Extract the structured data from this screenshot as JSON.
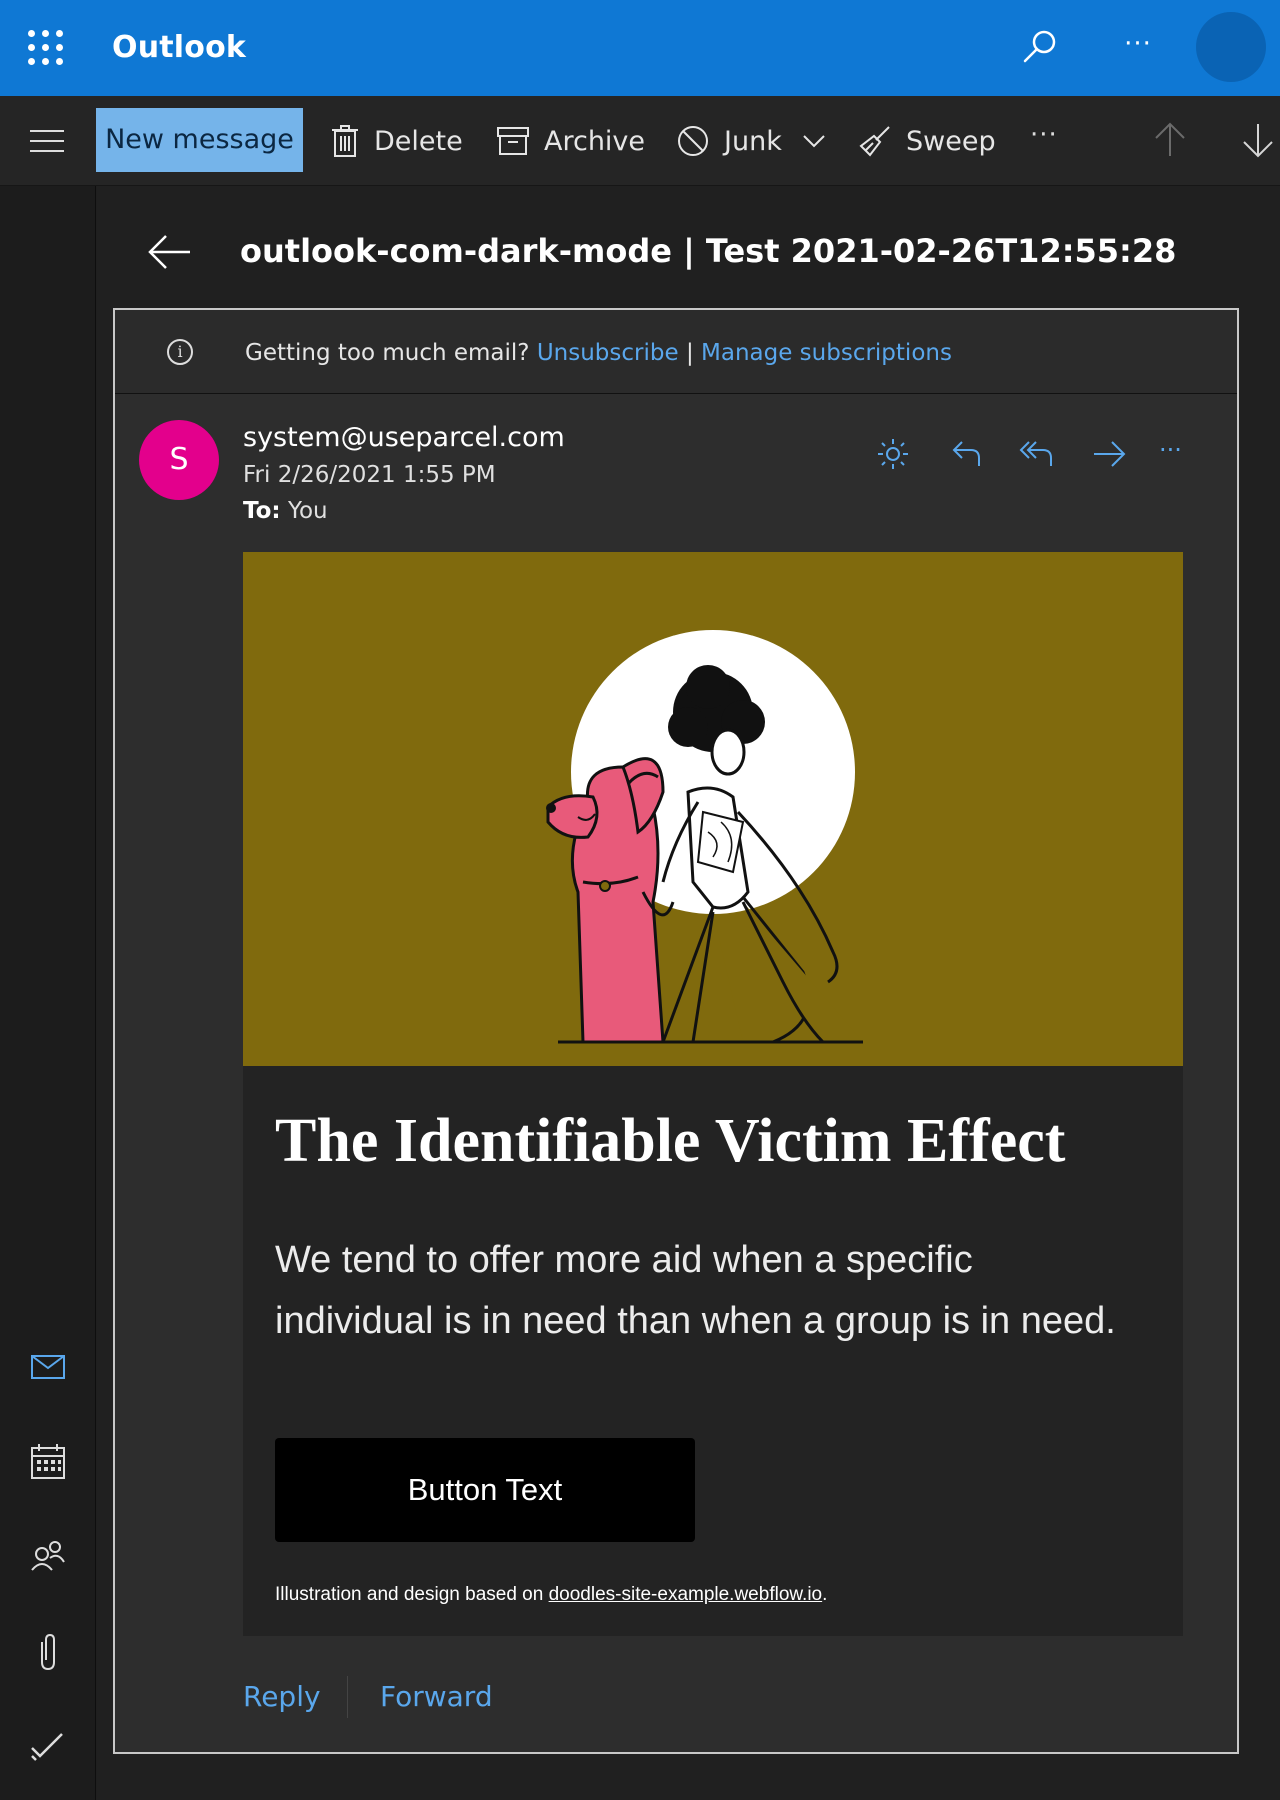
{
  "app": {
    "title": "Outlook"
  },
  "toolbar": {
    "new_message": "New message",
    "delete": "Delete",
    "archive": "Archive",
    "junk": "Junk",
    "sweep": "Sweep",
    "more": "···"
  },
  "message": {
    "subject": "outlook-com-dark-mode | Test 2021-02-26T12:55:28",
    "info_text": "Getting too much email?",
    "unsubscribe": "Unsubscribe",
    "separator": "|",
    "manage": "Manage subscriptions",
    "sender_initial": "S",
    "sender_email": "system@useparcel.com",
    "date": "Fri 2/26/2021 1:55 PM",
    "to_label": "To:",
    "to_value": "You",
    "more": "···"
  },
  "email_body": {
    "headline": "The Identifiable Victim Effect",
    "lede": "We tend to offer more aid when a specific individual is in need than when a group is in need.",
    "button": "Button Text",
    "credit_prefix": "Illustration and design based on ",
    "credit_link": "doodles-site-example.webflow.io",
    "credit_suffix": "."
  },
  "footer_actions": {
    "reply": "Reply",
    "forward": "Forward"
  },
  "colors": {
    "accent": "#0f78d4",
    "link": "#5aa7ec",
    "avatar": "#e3008c",
    "hero_background": "#806a0d",
    "dog": "#e85a7a"
  },
  "icons": [
    "waffle-icon",
    "search-icon",
    "more-icon",
    "hamburger-icon",
    "trash-icon",
    "archive-icon",
    "junk-icon",
    "chevron-down-icon",
    "sweep-icon",
    "arrow-up-icon",
    "arrow-down-icon",
    "mail-icon",
    "calendar-icon",
    "people-icon",
    "paperclip-icon",
    "checkmark-icon",
    "back-arrow-icon",
    "info-icon",
    "sun-icon",
    "reply-icon",
    "reply-all-icon",
    "forward-icon"
  ]
}
